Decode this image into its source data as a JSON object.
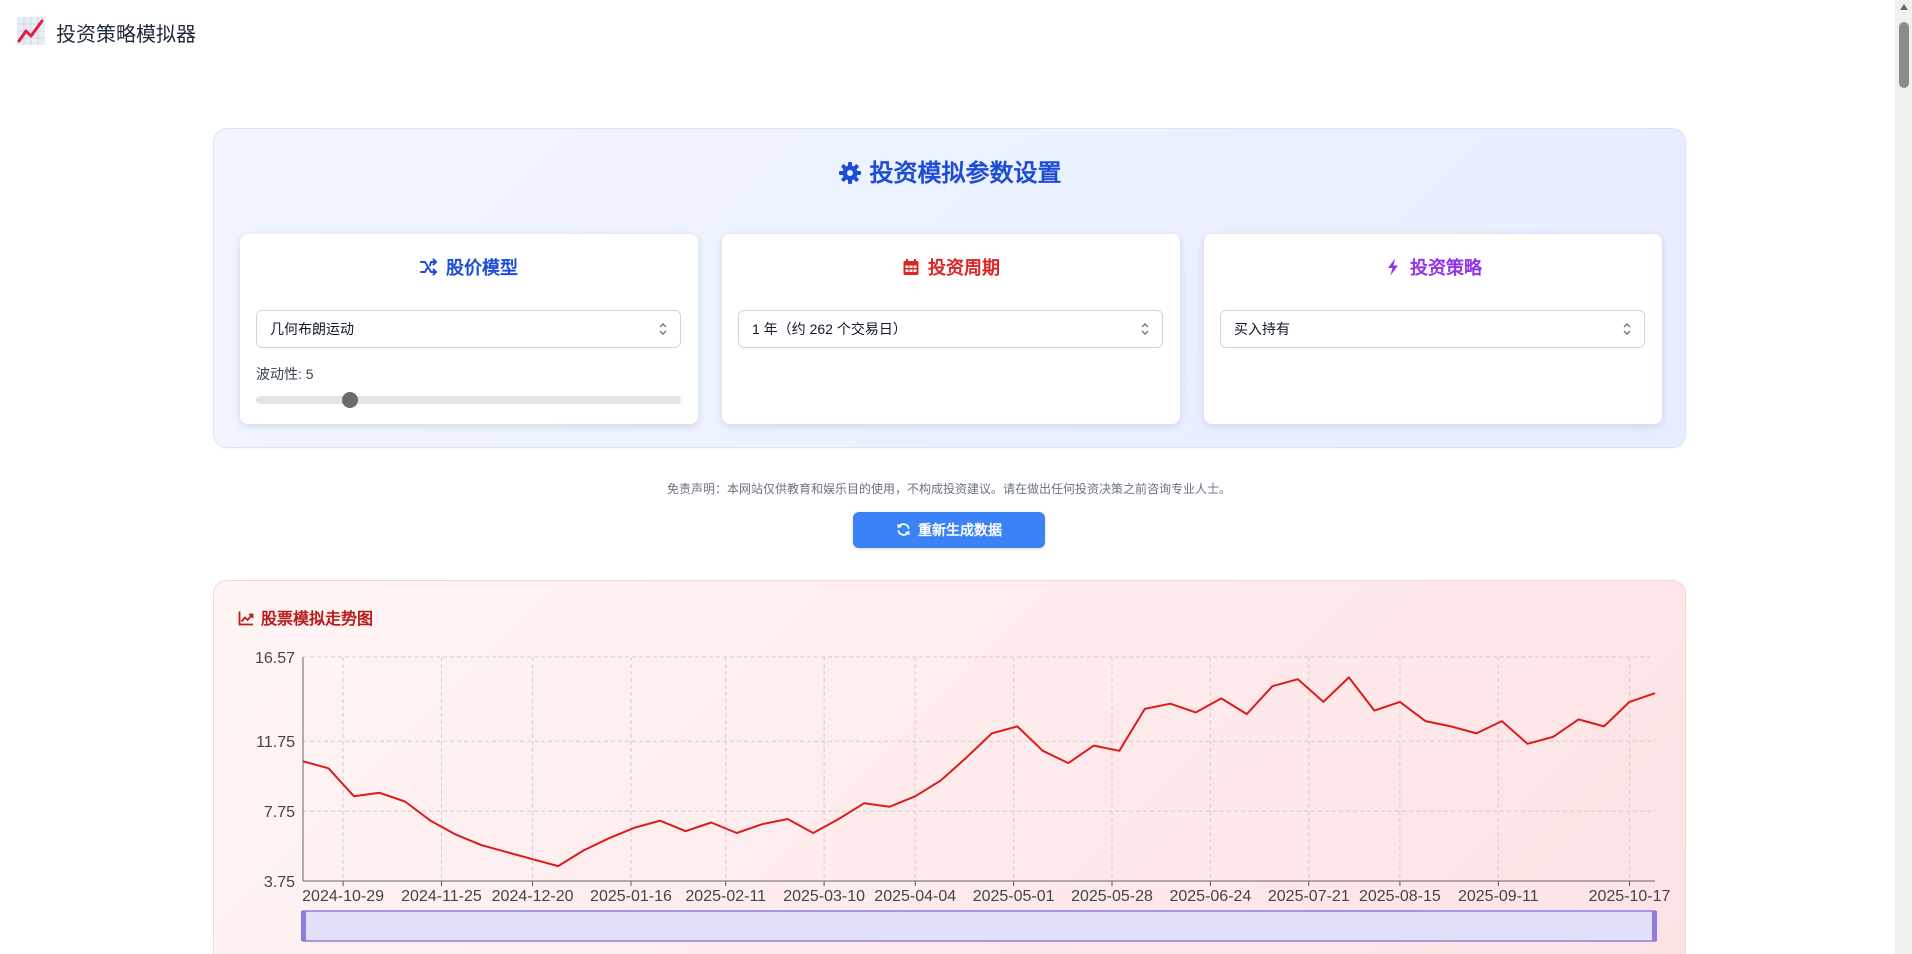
{
  "app": {
    "title": "投资策略模拟器"
  },
  "settings": {
    "title": "投资模拟参数设置",
    "model_card": {
      "title": "股价模型",
      "select_value": "几何布朗运动",
      "volatility_label": "波动性: 5",
      "volatility_level": 0.22
    },
    "period_card": {
      "title": "投资周期",
      "select_value": "1 年（约 262 个交易日）"
    },
    "strategy_card": {
      "title": "投资策略",
      "select_value": "买入持有"
    }
  },
  "disclaimer": "免责声明：本网站仅供教育和娱乐目的使用，不构成投资建议。请在做出任何投资决策之前咨询专业人士。",
  "regenerate_button": "重新生成数据",
  "chart_panel": {
    "title": "股票模拟走势图"
  },
  "colors": {
    "settings_title": "#1d4ed8",
    "model_title": "#1d4ed8",
    "period_title": "#dc2626",
    "strategy_title": "#9333ea",
    "button": "#3b82f6",
    "chart_title": "#b91c1c",
    "line": "#dc1c1c"
  },
  "icons": {
    "app": "chart-line-icon",
    "settings": "gear-icon",
    "model": "shuffle-icon",
    "period": "calendar-icon",
    "strategy": "bolt-icon",
    "regenerate": "refresh-icon",
    "chart": "chart-area-icon"
  },
  "chart_data": {
    "type": "line",
    "title": "",
    "xlabel": "",
    "ylabel": "",
    "ylim": [
      3.75,
      16.57
    ],
    "yticks": [
      "16.57",
      "11.75",
      "7.75",
      "3.75"
    ],
    "xticks": [
      "2024-10-29",
      "2024-11-25",
      "2024-12-20",
      "2025-01-16",
      "2025-02-11",
      "2025-03-10",
      "2025-04-04",
      "2025-05-01",
      "2025-05-28",
      "2025-06-24",
      "2025-07-21",
      "2025-08-15",
      "2025-09-11",
      "2025-10-17"
    ],
    "grid": true,
    "legend": "none",
    "has_zoom_slider": true,
    "series": [
      {
        "x": [
          "2024-10-18",
          "2024-10-25",
          "2024-11-01",
          "2024-11-08",
          "2024-11-15",
          "2024-11-22",
          "2024-11-29",
          "2024-12-06",
          "2024-12-13",
          "2024-12-20",
          "2024-12-27",
          "2025-01-03",
          "2025-01-10",
          "2025-01-17",
          "2025-01-24",
          "2025-01-31",
          "2025-02-07",
          "2025-02-14",
          "2025-02-21",
          "2025-02-28",
          "2025-03-07",
          "2025-03-14",
          "2025-03-21",
          "2025-03-28",
          "2025-04-04",
          "2025-04-11",
          "2025-04-18",
          "2025-04-25",
          "2025-05-02",
          "2025-05-09",
          "2025-05-16",
          "2025-05-23",
          "2025-05-30",
          "2025-06-06",
          "2025-06-13",
          "2025-06-20",
          "2025-06-27",
          "2025-07-04",
          "2025-07-11",
          "2025-07-18",
          "2025-07-25",
          "2025-08-01",
          "2025-08-08",
          "2025-08-15",
          "2025-08-22",
          "2025-08-29",
          "2025-09-05",
          "2025-09-12",
          "2025-09-19",
          "2025-09-26",
          "2025-10-03",
          "2025-10-10",
          "2025-10-17",
          "2025-10-24"
        ],
        "y": [
          10.6,
          10.2,
          8.6,
          8.8,
          8.3,
          7.2,
          6.4,
          5.8,
          5.4,
          5.0,
          4.6,
          5.5,
          6.2,
          6.8,
          7.2,
          6.6,
          7.1,
          6.5,
          7.0,
          7.3,
          6.5,
          7.3,
          8.2,
          8.0,
          8.6,
          9.5,
          10.8,
          12.2,
          12.6,
          11.2,
          10.5,
          11.5,
          11.2,
          13.6,
          13.9,
          13.4,
          14.2,
          13.3,
          14.9,
          15.3,
          14.0,
          15.4,
          13.5,
          14.0,
          12.9,
          12.6,
          12.2,
          12.9,
          11.6,
          12.0,
          13.0,
          12.6,
          14.0,
          14.5
        ]
      }
    ]
  }
}
